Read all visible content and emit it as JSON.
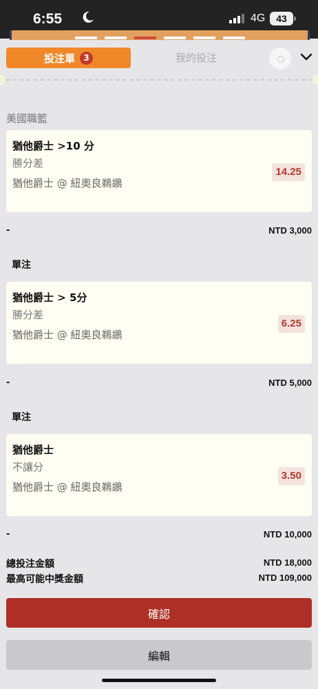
{
  "status_bar": {
    "time": "6:55",
    "network": "4G",
    "battery": "43"
  },
  "tabs": {
    "active_label": "投注單",
    "active_count": "3",
    "inactive_label": "我的投注"
  },
  "league": "美國職籃",
  "bets": [
    {
      "title": "猶他爵士 >10 分",
      "market": "勝分差",
      "match": "猶他爵士 @ 紐奧良鵜鶘",
      "odds": "14.25",
      "stake_left": "-",
      "stake": "NTD 3,000"
    },
    {
      "section": "單注",
      "title": "猶他爵士 > 5分",
      "market": "勝分差",
      "match": "猶他爵士 @ 紐奧良鵜鶘",
      "odds": "6.25",
      "stake_left": "-",
      "stake": "NTD 5,000"
    },
    {
      "section": "單注",
      "title": "猶他爵士",
      "market": "不讓分",
      "match": "猶他爵士 @ 紐奧良鵜鶘",
      "odds": "3.50",
      "stake_left": "-",
      "stake": "NTD 10,000"
    }
  ],
  "totals": {
    "total_label": "總投注金額",
    "total_value": "NTD 18,000",
    "max_label": "最高可能中獎金額",
    "max_value": "NTD 109,000"
  },
  "buttons": {
    "confirm": "確認",
    "edit": "編輯"
  },
  "colors": {
    "accent_orange": "#f0882a",
    "confirm_red": "#ad2f25",
    "odds_red": "#b33a2e"
  }
}
